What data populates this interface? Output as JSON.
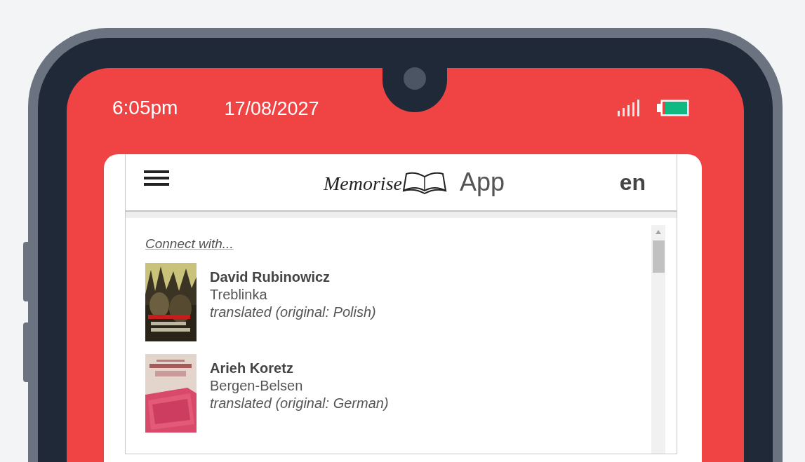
{
  "status_bar": {
    "time": "6:05pm",
    "date": "17/08/2027"
  },
  "app_header": {
    "logo_text": "Memorise",
    "title": "App",
    "language": "en"
  },
  "content": {
    "heading": "Connect with...",
    "people": [
      {
        "name": "David Rubinowicz",
        "place": "Treblinka",
        "note": "translated (original: Polish)"
      },
      {
        "name": "Arieh Koretz",
        "place": "Bergen-Belsen",
        "note": "translated (original: German)"
      }
    ]
  }
}
